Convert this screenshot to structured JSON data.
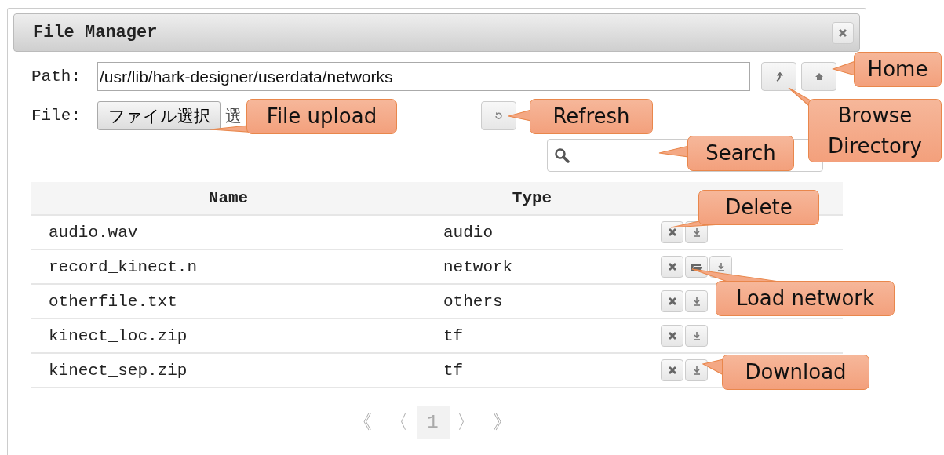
{
  "window": {
    "title": "File Manager"
  },
  "path": {
    "label": "Path:",
    "value": "/usr/lib/hark-designer/userdata/networks"
  },
  "file": {
    "label": "File:",
    "button": "ファイル選択",
    "status": "選"
  },
  "table": {
    "columns": [
      "Name",
      "Type"
    ],
    "rows": [
      {
        "name": "audio.wav",
        "type": "audio",
        "actions": [
          {
            "kind": "delete"
          },
          {
            "kind": "download"
          }
        ]
      },
      {
        "name": "record_kinect.n",
        "type": "network",
        "actions": [
          {
            "kind": "delete"
          },
          {
            "kind": "load"
          },
          {
            "kind": "download"
          }
        ]
      },
      {
        "name": "otherfile.txt",
        "type": "others",
        "actions": [
          {
            "kind": "delete"
          },
          {
            "kind": "download"
          }
        ]
      },
      {
        "name": "kinect_loc.zip",
        "type": "tf",
        "actions": [
          {
            "kind": "delete"
          },
          {
            "kind": "download"
          }
        ]
      },
      {
        "name": "kinect_sep.zip",
        "type": "tf",
        "actions": [
          {
            "kind": "delete"
          },
          {
            "kind": "download"
          }
        ]
      }
    ]
  },
  "pagination": {
    "first": "《",
    "prev": "〈",
    "pages": [
      {
        "label": "1",
        "selected": true
      }
    ],
    "next": "〉",
    "last": "》"
  },
  "callouts": [
    {
      "kind": "home",
      "text": "Home"
    },
    {
      "kind": "upload",
      "text": "File upload"
    },
    {
      "kind": "refresh",
      "text": "Refresh"
    },
    {
      "kind": "search",
      "text": "Search"
    },
    {
      "kind": "browse",
      "text": "Browse Directory"
    },
    {
      "kind": "delete",
      "text": "Delete"
    },
    {
      "kind": "load",
      "text": "Load network"
    },
    {
      "kind": "download",
      "text": "Download"
    }
  ]
}
